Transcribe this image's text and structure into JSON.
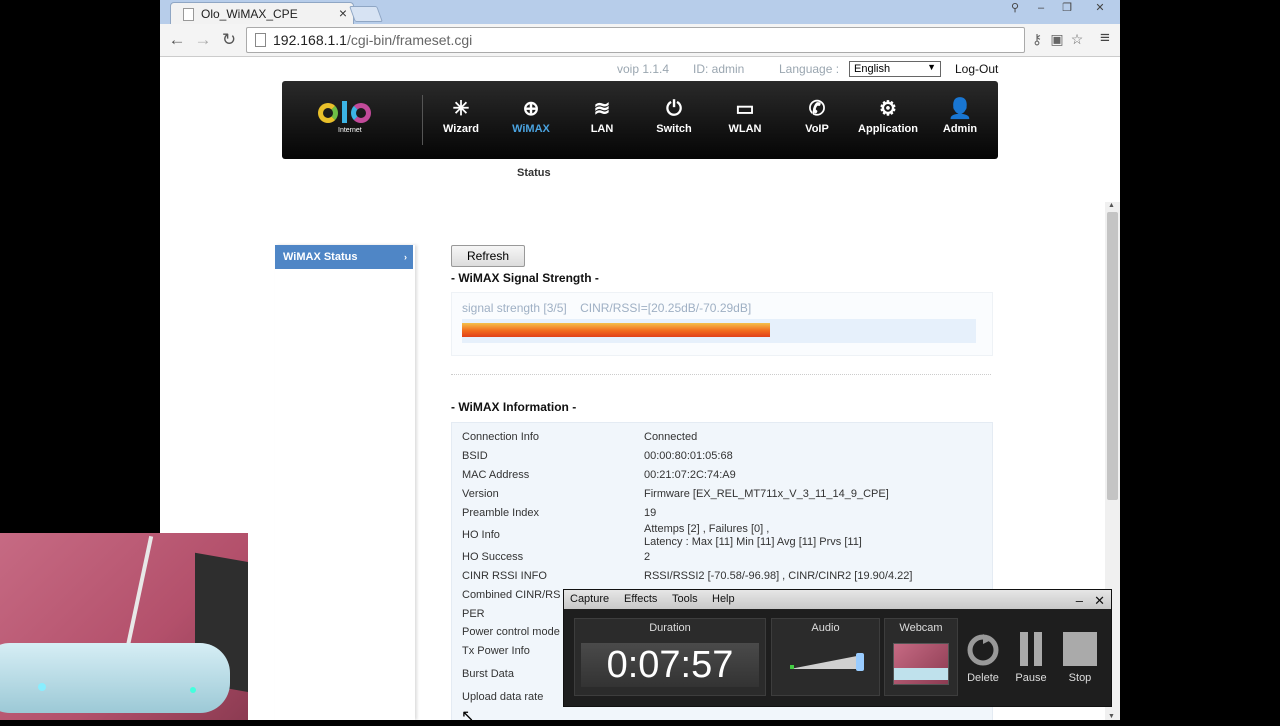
{
  "browser": {
    "tab_title": "Olo_WiMAX_CPE",
    "tab_close": "×",
    "url_host": "192.168.1.1",
    "url_path": "/cgi-bin/frameset.cgi",
    "back": "←",
    "forward": "→",
    "reload": "↻",
    "menu": "≡",
    "star": "☆"
  },
  "header": {
    "voip": "voip 1.1.4",
    "id": "ID: admin",
    "language_label": "Language :",
    "language_value": "English",
    "logout": "Log-Out"
  },
  "logo": {
    "sub": "Internet"
  },
  "nav": {
    "items": [
      {
        "label": "Wizard",
        "icon": "✳"
      },
      {
        "label": "WiMAX",
        "icon": "⊕"
      },
      {
        "label": "LAN",
        "icon": "≋"
      },
      {
        "label": "Switch",
        "icon": "⏻"
      },
      {
        "label": "WLAN",
        "icon": "▭"
      },
      {
        "label": "VoIP",
        "icon": "✆"
      },
      {
        "label": "Application",
        "icon": "⚙"
      },
      {
        "label": "Admin",
        "icon": "👤"
      }
    ],
    "active": "WiMAX",
    "active_color": "#4aa3e0",
    "subnav": "Status"
  },
  "sidebar": {
    "items": [
      {
        "label": "WiMAX Status"
      }
    ]
  },
  "main": {
    "refresh_label": "Refresh",
    "signal_heading": "- WiMAX Signal Strength -",
    "signal_text": "signal strength [3/5]",
    "cinr_text": "CINR/RSSI=[20.25dB/-70.29dB]",
    "signal_level": 0.6,
    "info_heading": "- WiMAX Information -",
    "rows": [
      {
        "label": "Connection Info",
        "value": "Connected"
      },
      {
        "label": "BSID",
        "value": "00:00:80:01:05:68"
      },
      {
        "label": "MAC Address",
        "value": "00:21:07:2C:74:A9"
      },
      {
        "label": "Version",
        "value": "Firmware [EX_REL_MT711x_V_3_11_14_9_CPE]"
      },
      {
        "label": "Preamble Index",
        "value": "19"
      },
      {
        "label": "HO Info",
        "value": "Attemps [2] , Failures [0] ,",
        "value2": "Latency : Max [11] Min [11] Avg [11] Prvs [11]"
      },
      {
        "label": "HO Success",
        "value": "2"
      },
      {
        "label": "CINR RSSI INFO",
        "value": "RSSI/RSSI2 [-70.58/-96.98] , CINR/CINR2 [19.90/4.22]"
      },
      {
        "label": "Combined CINR/RS",
        "value": ""
      },
      {
        "label": "PER",
        "value": ""
      },
      {
        "label": "Power control mode",
        "value": ""
      },
      {
        "label": "Tx Power Info",
        "value": ""
      },
      {
        "label": "Burst Data",
        "value": ""
      },
      {
        "label": "Upload data rate",
        "value": ""
      }
    ]
  },
  "recorder": {
    "menu": [
      "Capture",
      "Effects",
      "Tools",
      "Help"
    ],
    "duration_label": "Duration",
    "duration": "0:07:57",
    "audio_label": "Audio",
    "webcam_label": "Webcam",
    "delete": "Delete",
    "pause": "Pause",
    "stop": "Stop"
  }
}
